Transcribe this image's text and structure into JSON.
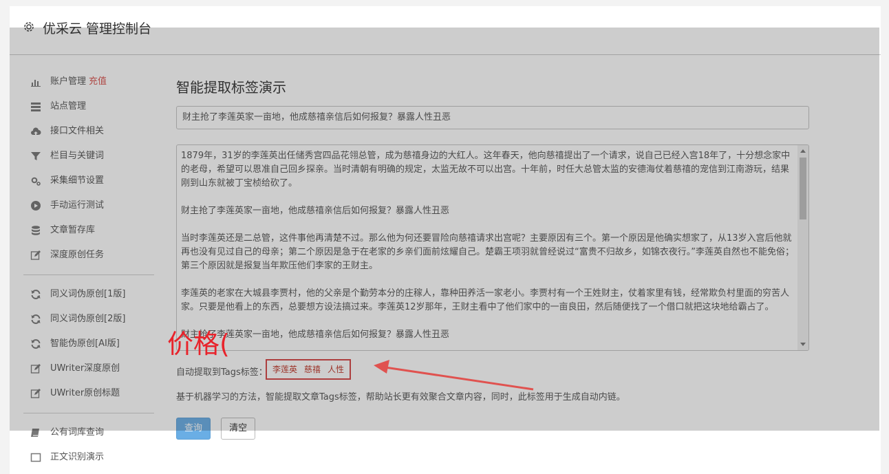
{
  "header": {
    "title": "优采云 管理控制台",
    "icon": "gear-icon"
  },
  "sidebar": {
    "group1": [
      {
        "id": "account",
        "icon": "bar-chart-icon",
        "label": "账户管理",
        "badge": "充值"
      },
      {
        "id": "site",
        "icon": "list-icon",
        "label": "站点管理"
      },
      {
        "id": "api",
        "icon": "cloud-upload-icon",
        "label": "接口文件相关"
      },
      {
        "id": "column",
        "icon": "filter-icon",
        "label": "栏目与关键词"
      },
      {
        "id": "collect",
        "icon": "gears-icon",
        "label": "采集细节设置"
      },
      {
        "id": "manual",
        "icon": "play-circle-icon",
        "label": "手动运行测试"
      },
      {
        "id": "store",
        "icon": "database-icon",
        "label": "文章暂存库"
      },
      {
        "id": "deep",
        "icon": "edit-icon",
        "label": "深度原创任务"
      }
    ],
    "group2": [
      {
        "id": "syn1",
        "icon": "refresh-icon",
        "label": "同义词伪原创[1版]"
      },
      {
        "id": "syn2",
        "icon": "refresh-icon",
        "label": "同义词伪原创[2版]"
      },
      {
        "id": "ai",
        "icon": "refresh-icon",
        "label": "智能伪原创[AI版]"
      },
      {
        "id": "uw1",
        "icon": "edit-icon",
        "label": "UWriter深度原创"
      },
      {
        "id": "uw2",
        "icon": "edit-icon",
        "label": "UWriter原创标题"
      }
    ],
    "group3": [
      {
        "id": "dict",
        "icon": "book-icon",
        "label": "公有词库查询"
      },
      {
        "id": "ocr",
        "icon": "square-icon",
        "label": "正文识别演示"
      }
    ]
  },
  "main": {
    "page_title": "智能提取标签演示",
    "title_input_value": "财主抢了李莲英家一亩地，他成慈禧亲信后如何报复？暴露人性丑恶",
    "content_paragraphs": [
      "1879年，31岁的李莲英出任储秀宫四品花翎总管，成为慈禧身边的大红人。这年春天，他向慈禧提出了一个请求，说自己已经入宫18年了，十分想念家中的老母，希望可以恩准自己回乡探亲。当时清朝有明确的规定，太监无故不可以出宫。十年前，时任大总管太监的安德海仗着慈禧的宠信到江南游玩，结果刚到山东就被丁宝桢给砍了。",
      "财主抢了李莲英家一亩地，他成慈禧亲信后如何报复？暴露人性丑恶",
      "当时李莲英还是二总管，这件事他再清楚不过。那么他为何还要冒险向慈禧请求出宫呢？主要原因有三个。第一个原因是他确实想家了，从13岁入宫后他就再也没有见过自己的母亲；第二个原因是急于在老家的乡亲们面前炫耀自己。楚霸王项羽就曾经说过“富贵不归故乡，如锦衣夜行。”李莲英自然也不能免俗；第三个原因就是报复当年欺压他们李家的王财主。",
      "李莲英的老家在大城县李贾村，他的父亲是个勤劳本分的庄稼人，靠种田养活一家老小。李贾村有一个王姓财主，仗着家里有钱，经常欺负村里面的穷苦人家。只要是他看上的东西，总要想方设法搞过来。李莲英12岁那年，王财主看中了他们家中的一亩良田，然后随便找了一个借口就把这块地给霸占了。",
      "财主抢了李莲英家一亩地，他成慈禧亲信后如何报复？暴露人性丑恶"
    ],
    "tags_label": "自动提取到Tags标签：",
    "tags": [
      "李莲英",
      "慈禧",
      "人性"
    ],
    "description": "基于机器学习的方法，智能提取文章Tags标签，帮助站长更有效聚合文章内容，同时，此标签用于生成自动内链。",
    "query_button": "查询",
    "clear_button": "清空"
  },
  "annotation": {
    "text": "价格(",
    "color": "#e8232b"
  }
}
